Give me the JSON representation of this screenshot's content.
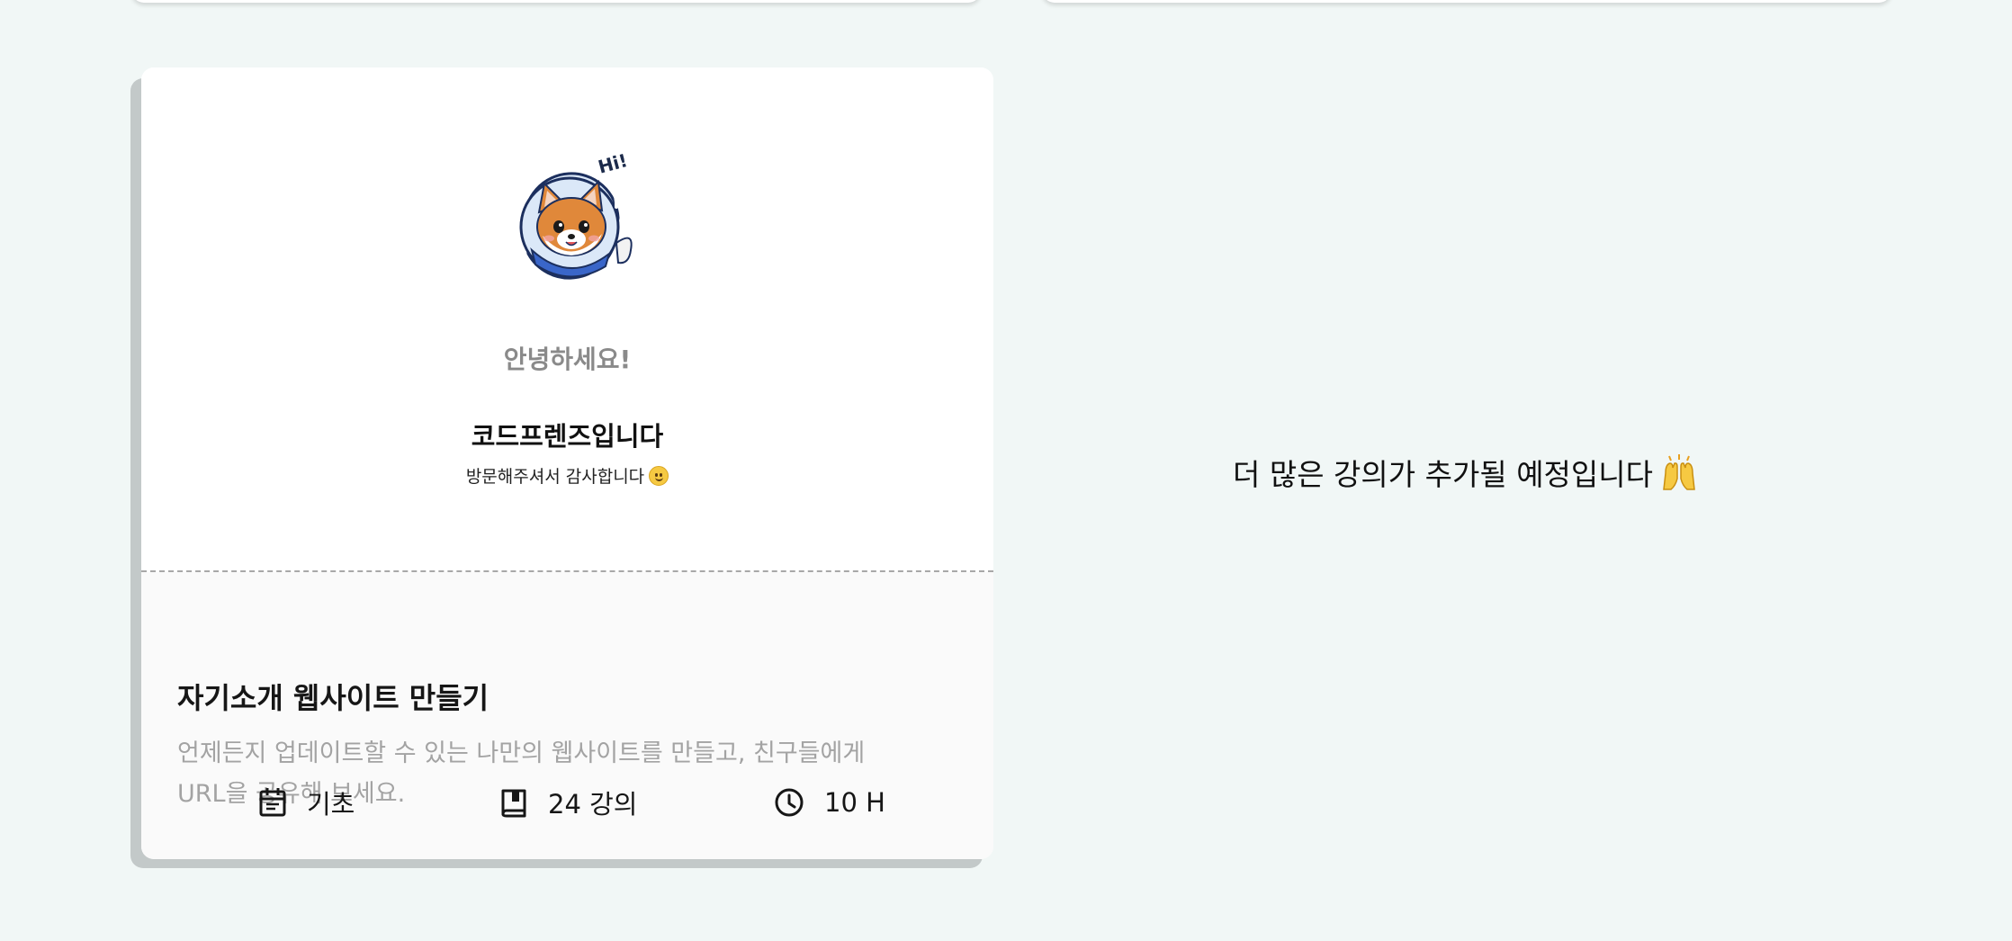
{
  "featured_course": {
    "preview": {
      "greeting": "안녕하세요!",
      "brand": "코드프렌즈입니다",
      "thanks": "방문해주셔서 감사합니다",
      "mascot_caption": "Hi!"
    },
    "title": "자기소개 웹사이트 만들기",
    "description": "언제든지 업데이트할 수 있는 나만의 웹사이트를 만들고, 친구들에게 URL을 공유해 보세요.",
    "meta": {
      "level": "기초",
      "lectures": "24 강의",
      "hours": "10 H"
    }
  },
  "coming_soon": {
    "text": "더 많은 강의가 추가될 예정입니다"
  },
  "icons": {
    "level": "calendar-icon",
    "lectures": "book-icon",
    "hours": "clock-icon",
    "thanks": "smile-emoji",
    "coming_soon": "raised-hands-emoji"
  },
  "colors": {
    "background": "#f1f7f6",
    "card": "#ffffff",
    "card_bottom": "#fafafa",
    "card_shadow": "#c3c9c9",
    "muted_text": "#a3a3a3",
    "mascot_helmet": "#dbe8f8",
    "mascot_fur": "#e0883a",
    "mascot_collar": "#3a66c9"
  }
}
